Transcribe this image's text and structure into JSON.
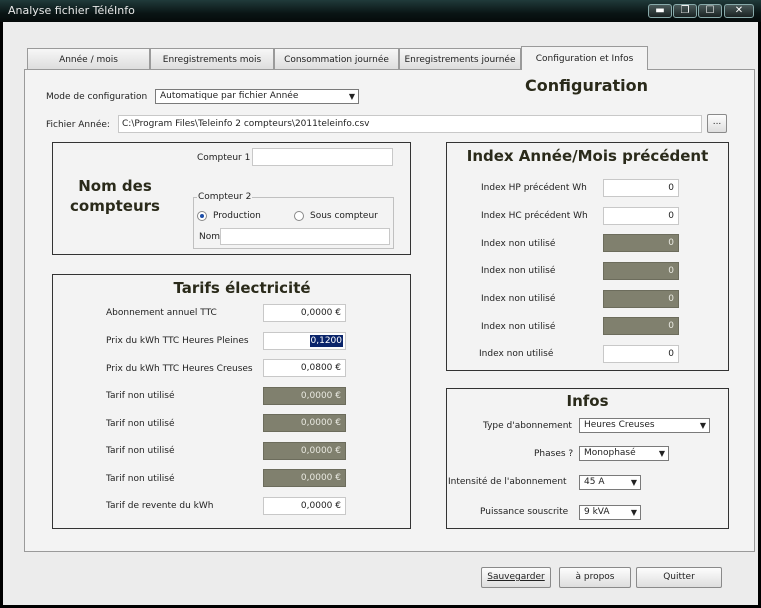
{
  "window": {
    "title": "Analyse fichier TéléInfo",
    "min": "▬",
    "restore": "❐",
    "max": "☐",
    "close": "✕"
  },
  "tabs": [
    "Année / mois",
    "Enregistrements mois",
    "Consommation journée",
    "Enregistrements journée",
    "Configuration et Infos"
  ],
  "config": {
    "heading": "Configuration",
    "mode_label": "Mode de configuration",
    "mode_value": "Automatique par fichier Année",
    "file_label": "Fichier Année:",
    "file_value": "C:\\Program Files\\Teleinfo 2 compteurs\\2011teleinfo.csv",
    "browse": "..."
  },
  "noms": {
    "title": "Nom des compteurs",
    "compteur1_label": "Compteur 1",
    "compteur1_value": "",
    "compteur2_group": "Compteur 2",
    "production": "Production",
    "sous_compteur": "Sous compteur",
    "nom_label": "Nom",
    "nom_value": ""
  },
  "tarifs": {
    "title": "Tarifs électricité",
    "rows": [
      {
        "label": "Abonnement annuel TTC",
        "value": "0,0000 €"
      },
      {
        "label": "Prix du kWh TTC Heures Pleines",
        "value": "0,1200"
      },
      {
        "label": "Prix du kWh TTC Heures Creuses",
        "value": "0,0800 €"
      },
      {
        "label": "Tarif non utilisé",
        "value": "0,0000 €"
      },
      {
        "label": "Tarif non utilisé",
        "value": "0,0000 €"
      },
      {
        "label": "Tarif non utilisé",
        "value": "0,0000 €"
      },
      {
        "label": "Tarif non utilisé",
        "value": "0,0000 €"
      },
      {
        "label": "Tarif de revente du kWh",
        "value": "0,0000 €"
      }
    ]
  },
  "index": {
    "title": "Index Année/Mois précédent",
    "rows": [
      {
        "label": "Index HP précédent Wh",
        "value": "0"
      },
      {
        "label": "Index HC précédent Wh",
        "value": "0"
      },
      {
        "label": "Index non utilisé",
        "value": "0"
      },
      {
        "label": "Index non utilisé",
        "value": "0"
      },
      {
        "label": "Index non utilisé",
        "value": "0"
      },
      {
        "label": "Index non utilisé",
        "value": "0"
      },
      {
        "label": "Index non utilisé",
        "value": "0"
      }
    ]
  },
  "infos": {
    "title": "Infos",
    "rows": [
      {
        "label": "Type d'abonnement",
        "value": "Heures Creuses"
      },
      {
        "label": "Phases ?",
        "value": "Monophasé"
      },
      {
        "label": "Intensité de l'abonnement",
        "value": "45 A"
      },
      {
        "label": "Puissance souscrite",
        "value": "9 kVA"
      }
    ]
  },
  "buttons": {
    "save": "Sauvegarder",
    "about": "à propos",
    "quit": "Quitter"
  }
}
